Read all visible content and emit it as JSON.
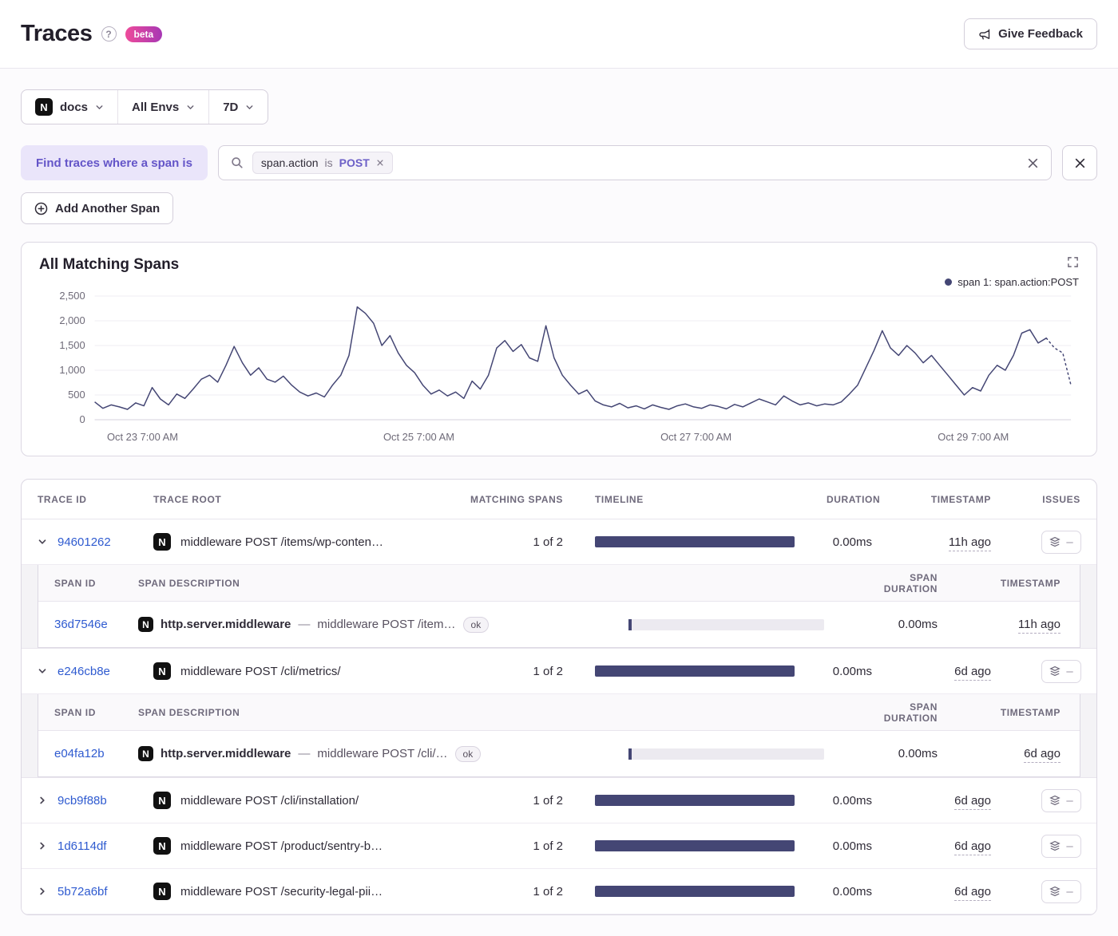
{
  "colors": {
    "accent": "#6C5FC7",
    "series": "#444674",
    "link": "#2F5BD0",
    "beta_from": "#EE4B9A",
    "beta_to": "#A737B4"
  },
  "icons": {
    "help": "?",
    "project_letter": "N"
  },
  "header": {
    "title": "Traces",
    "beta_label": "beta",
    "feedback_label": "Give Feedback"
  },
  "filters": {
    "project": "docs",
    "environment": "All Envs",
    "date_range": "7D"
  },
  "search": {
    "find_label": "Find traces where a span is",
    "token_key": "span.action",
    "token_operator": "is",
    "token_value": "POST",
    "add_span_label": "Add Another Span"
  },
  "chart": {
    "title": "All Matching Spans",
    "legend": "span 1: span.action:POST"
  },
  "chart_data": {
    "type": "line",
    "title": "All Matching Spans",
    "xlabel": "",
    "ylabel": "",
    "ylim": [
      0,
      2500
    ],
    "grid": true,
    "legend_position": "top-right",
    "y_ticks": [
      0,
      500,
      1000,
      1500,
      2000,
      2500
    ],
    "y_tick_labels": [
      "0",
      "500",
      "1,000",
      "1,500",
      "2,000",
      "2,500"
    ],
    "x_ticks": [
      {
        "label": "Oct 23 7:00 AM",
        "pos": 0.049
      },
      {
        "label": "Oct 25 7:00 AM",
        "pos": 0.332
      },
      {
        "label": "Oct 27 7:00 AM",
        "pos": 0.616
      },
      {
        "label": "Oct 29 7:00 AM",
        "pos": 0.9
      }
    ],
    "dashed_tail_points": 4,
    "series": [
      {
        "name": "span 1: span.action:POST",
        "color": "#444674",
        "values": [
          360,
          230,
          300,
          260,
          210,
          340,
          280,
          650,
          420,
          300,
          520,
          430,
          620,
          820,
          900,
          760,
          1100,
          1480,
          1150,
          900,
          1050,
          820,
          760,
          880,
          700,
          560,
          480,
          540,
          460,
          700,
          900,
          1300,
          2280,
          2150,
          1950,
          1500,
          1700,
          1350,
          1100,
          950,
          700,
          520,
          600,
          480,
          560,
          430,
          780,
          620,
          900,
          1450,
          1600,
          1380,
          1520,
          1250,
          1180,
          1900,
          1250,
          900,
          700,
          520,
          600,
          380,
          300,
          260,
          330,
          240,
          280,
          220,
          300,
          250,
          210,
          280,
          320,
          260,
          230,
          300,
          270,
          220,
          310,
          260,
          340,
          420,
          360,
          300,
          480,
          380,
          300,
          340,
          280,
          320,
          300,
          360,
          520,
          700,
          1050,
          1400,
          1800,
          1450,
          1300,
          1500,
          1350,
          1150,
          1300,
          1100,
          900,
          700,
          500,
          650,
          580,
          900,
          1100,
          1000,
          1300,
          1750,
          1820,
          1550,
          1650,
          1450,
          1350,
          700
        ]
      }
    ]
  },
  "table": {
    "headers": {
      "trace_id": "TRACE ID",
      "trace_root": "TRACE ROOT",
      "matching_spans": "MATCHING SPANS",
      "timeline": "TIMELINE",
      "duration": "DURATION",
      "timestamp": "TIMESTAMP",
      "issues": "ISSUES"
    },
    "span_headers": {
      "span_id": "SPAN ID",
      "description": "SPAN DESCRIPTION",
      "duration": "SPAN DURATION",
      "timestamp": "TIMESTAMP"
    },
    "issues_empty": "–",
    "separator": "—",
    "rows": [
      {
        "trace_id": "94601262",
        "root": "middleware POST /items/wp-conten…",
        "matching": "1 of 2",
        "duration": "0.00ms",
        "timestamp": "11h ago",
        "spans": [
          {
            "span_id": "36d7546e",
            "operation": "http.server.middleware",
            "description": "middleware POST /item…",
            "status": "ok",
            "duration": "0.00ms",
            "timestamp": "11h ago"
          }
        ]
      },
      {
        "trace_id": "e246cb8e",
        "root": "middleware POST /cli/metrics/",
        "matching": "1 of 2",
        "duration": "0.00ms",
        "timestamp": "6d ago",
        "spans": [
          {
            "span_id": "e04fa12b",
            "operation": "http.server.middleware",
            "description": "middleware POST /cli/…",
            "status": "ok",
            "duration": "0.00ms",
            "timestamp": "6d ago"
          }
        ]
      },
      {
        "trace_id": "9cb9f88b",
        "root": "middleware POST /cli/installation/",
        "matching": "1 of 2",
        "duration": "0.00ms",
        "timestamp": "6d ago"
      },
      {
        "trace_id": "1d6114df",
        "root": "middleware POST /product/sentry-b…",
        "matching": "1 of 2",
        "duration": "0.00ms",
        "timestamp": "6d ago"
      },
      {
        "trace_id": "5b72a6bf",
        "root": "middleware POST /security-legal-pii…",
        "matching": "1 of 2",
        "duration": "0.00ms",
        "timestamp": "6d ago"
      }
    ]
  }
}
